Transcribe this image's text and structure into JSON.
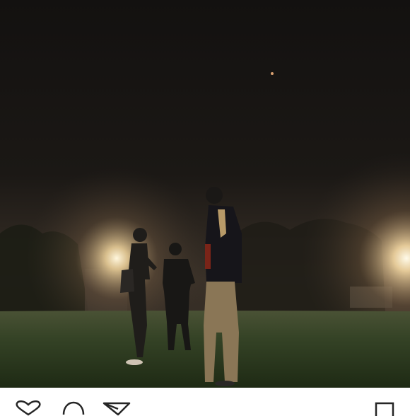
{
  "post": {
    "image": {
      "subject": "night-scene-three-people-on-field",
      "icon": "photo-icon"
    }
  },
  "actions": {
    "like": {
      "icon": "heart-icon"
    },
    "comment": {
      "icon": "comment-icon"
    },
    "share": {
      "icon": "send-icon"
    },
    "save": {
      "icon": "bookmark-icon"
    }
  },
  "colors": {
    "sky": "#161412",
    "glow": "#f6e6c2",
    "grass": "#2c3a1f",
    "icon_stroke": "#262626"
  }
}
